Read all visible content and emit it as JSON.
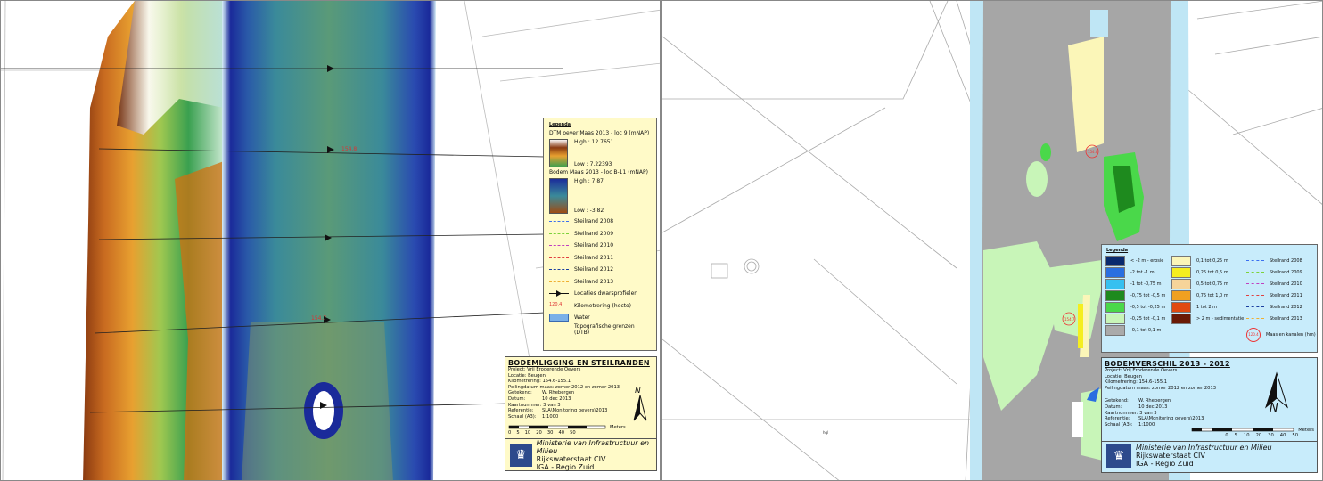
{
  "left_map": {
    "legend": {
      "heading": "Legenda",
      "dtm_title": "DTM oever Maas 2013 - loc 9 (mNAP)",
      "dtm_high": "High : 12.7651",
      "dtm_low": "Low : 7.22393",
      "bodem_title": "Bodem Maas 2013 - loc B-11 (mNAP)",
      "bodem_high": "High : 7.87",
      "bodem_low": "Low : -3.82",
      "lines": [
        {
          "label": "Steilrand 2008",
          "color": "#3a6ff0"
        },
        {
          "label": "Steilrand 2009",
          "color": "#7dd23a"
        },
        {
          "label": "Steilrand 2010",
          "color": "#c040c0"
        },
        {
          "label": "Steilrand 2011",
          "color": "#e04040"
        },
        {
          "label": "Steilrand 2012",
          "color": "#1b3fa0"
        },
        {
          "label": "Steilrand 2013",
          "color": "#f0b030"
        }
      ],
      "profiel_label": "Locaties dwarsprofielen",
      "km_label": "Kilometrering (hecto)",
      "km_symbol": "120.4",
      "water_label": "Water",
      "topo_label": "Topografische grenzen (DTB)"
    },
    "km_markers": [
      "154.8",
      "154.7"
    ],
    "title_block": {
      "title": "BODEMLIGGING EN STEILRANDEN",
      "project": "Project: Vrij Eroderende Oevers",
      "locatie": "Locatie: Beugen",
      "kilometrering": "Kilometrering:  154.6-155.1",
      "peiling": "Peilingdatum maas: zomer 2012 en zomer 2013",
      "getekend_k": "Getekend:",
      "getekend_v": "W. Rhebergen",
      "datum_k": "Datum:",
      "datum_v": "10 dec 2013",
      "kaart_k": "Kaartnummer: 3 van 3",
      "kaart_v": "",
      "ref_k": "Referentie:",
      "ref_v": "SLA\\Monitoring oevers\\2013",
      "schaal_k": "Schaal (A3):",
      "schaal_v": "1:1000",
      "scale_ticks": [
        "0",
        "5",
        "10",
        "20",
        "30",
        "40",
        "50"
      ],
      "scale_unit": "Meters",
      "north": "N",
      "org_line1": "Ministerie van Infrastructuur en Milieu",
      "org_line2": "Rijkswaterstaat CIV",
      "org_line3": "IGA - Regio Zuid"
    }
  },
  "right_map": {
    "legend": {
      "heading": "Legenda",
      "col1": [
        {
          "label": "< -2 m - erosie",
          "color": "#0a2a6e"
        },
        {
          "label": "-2 tot -1 m",
          "color": "#2a6fe0"
        },
        {
          "label": "-1 tot -0,75 m",
          "color": "#35c0f0"
        },
        {
          "label": "-0,75 tot -0,5 m",
          "color": "#1e8a1e"
        },
        {
          "label": "-0,5 tot -0,25 m",
          "color": "#4ad84a"
        },
        {
          "label": "-0,25 tot -0,1 m",
          "color": "#c8f5b8"
        },
        {
          "label": "-0,1 tot 0,1 m",
          "color": "#aaaaaa"
        }
      ],
      "col2": [
        {
          "label": "0,1 tot 0,25 m",
          "color": "#fbf6b8"
        },
        {
          "label": "0,25 tot 0,5 m",
          "color": "#f5ee20"
        },
        {
          "label": "0,5 tot 0,75 m",
          "color": "#f6d49a"
        },
        {
          "label": "0,75 tot 1,0 m",
          "color": "#f0a020"
        },
        {
          "label": "1 tot 2 m",
          "color": "#e04a10"
        },
        {
          "label": "> 2 m - sedimentatie",
          "color": "#6a1a05"
        }
      ],
      "col3": [
        {
          "label": "Steilrand 2008",
          "color": "#3a6ff0"
        },
        {
          "label": "Steilrand 2009",
          "color": "#7dd23a"
        },
        {
          "label": "Steilrand 2010",
          "color": "#c040c0"
        },
        {
          "label": "Steilrand 2011",
          "color": "#e04040"
        },
        {
          "label": "Steilrand 2012",
          "color": "#1b3fa0"
        },
        {
          "label": "Steilrand 2013",
          "color": "#f0b030"
        }
      ],
      "km_label": "Maas en kanalen (hm)",
      "km_symbol": "120.4"
    },
    "km_markers": [
      "154.8",
      "154.7"
    ],
    "small_label": "hgl",
    "title_block": {
      "title": "BODEMVERSCHIL 2013 - 2012",
      "project": "Project: Vrij Eroderende Oevers",
      "locatie": "Locatie: Beugen",
      "kilometrering": "Kilometrering:  154.6-155.1",
      "peiling": "Peilingdatum maas: zomer 2012 en zomer 2013",
      "getekend_k": "Getekend:",
      "getekend_v": "W. Rhebergen",
      "datum_k": "Datum:",
      "datum_v": "10 dec 2013",
      "kaart_k": "Kaartnummer: 3 van 3",
      "kaart_v": "",
      "ref_k": "Referentie:",
      "ref_v": "SLA\\Monitoring oevers\\2013",
      "schaal_k": "Schaal (A3):",
      "schaal_v": "1:1000",
      "scale_ticks": [
        "0",
        "5",
        "10",
        "20",
        "30",
        "40",
        "50"
      ],
      "scale_unit": "Meters",
      "north": "N",
      "org_line1": "Ministerie van Infrastructuur en Milieu",
      "org_line2": "Rijkswaterstaat CIV",
      "org_line3": "IGA - Regio Zuid"
    }
  }
}
